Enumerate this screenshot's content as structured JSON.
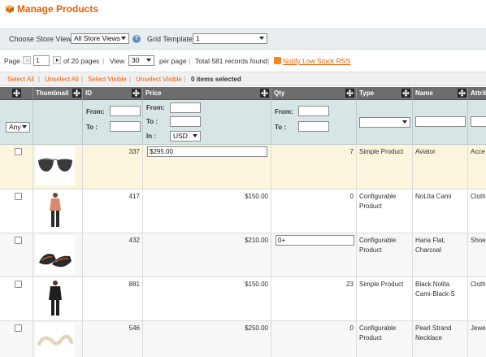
{
  "header": {
    "title": "Manage Products"
  },
  "store_bar": {
    "store_label": "Choose Store View:",
    "store_value": "All Store Views",
    "help": "?",
    "grid_label": "Grid Template:",
    "grid_value": "1"
  },
  "pager": {
    "page_label": "Page",
    "page_value": "1",
    "of_pages": "of 20 pages",
    "sep1": "|",
    "view_label": "View",
    "view_value": "30",
    "per_page": "per page",
    "sep2": "|",
    "total": "Total 581 records found",
    "sep3": "|",
    "rss": "Notify Low Stock RSS"
  },
  "mass": {
    "select_all": "Select All",
    "unselect_all": "Unselect All",
    "select_visible": "Select Visible",
    "unselect_visible": "Unselect Visible",
    "sep": "|",
    "count": "0 items selected"
  },
  "columns": {
    "thumbnail": "Thumbnail",
    "id": "ID",
    "price": "Price",
    "qty": "Qty",
    "type": "Type",
    "name": "Name",
    "attr": "Attrib"
  },
  "filters": {
    "any": "Any",
    "from": "From:",
    "to": "To :",
    "in": "In :",
    "currency": "USD"
  },
  "rows": [
    {
      "id": "337",
      "price": "",
      "price_edit": "$295.00",
      "qty": "7",
      "qty_edit": "",
      "type": "Simple Product",
      "name": "Aviator",
      "attr": "Acce"
    },
    {
      "id": "417",
      "price": "$150.00",
      "price_edit": "",
      "qty": "0",
      "qty_edit": "",
      "type": "Configurable Product",
      "name": "NoLIta Cami",
      "attr": "Cloth"
    },
    {
      "id": "432",
      "price": "$210.00",
      "price_edit": "",
      "qty": "",
      "qty_edit": "0+",
      "type": "Configurable Product",
      "name": "Hana Flat, Charcoal",
      "attr": "Shoe"
    },
    {
      "id": "881",
      "price": "$150.00",
      "price_edit": "",
      "qty": "23",
      "qty_edit": "",
      "type": "Simple Product",
      "name": "Black Nolita Cami-Black-S",
      "attr": "Cloth"
    },
    {
      "id": "546",
      "price": "$250.00",
      "price_edit": "",
      "qty": "0",
      "qty_edit": "",
      "type": "Configurable Product",
      "name": "Pearl Strand Necklace",
      "attr": "Jewe"
    }
  ],
  "colors": {
    "accent": "#eb5e00",
    "header_bg": "#6d6d6d",
    "filter_bg": "#d8e5e7",
    "highlight_row": "#fcf5dd"
  }
}
